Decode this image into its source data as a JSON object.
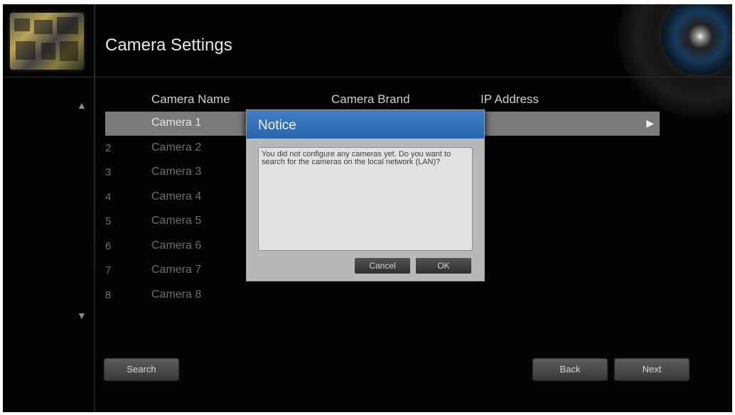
{
  "header": {
    "title": "Camera Settings"
  },
  "columns": {
    "name": "Camera Name",
    "brand": "Camera Brand",
    "ip": "IP Address"
  },
  "cameras": [
    {
      "num": "",
      "name": "Camera 1",
      "selected": true
    },
    {
      "num": "2",
      "name": "Camera 2"
    },
    {
      "num": "3",
      "name": "Camera 3"
    },
    {
      "num": "4",
      "name": "Camera 4"
    },
    {
      "num": "5",
      "name": "Camera 5"
    },
    {
      "num": "6",
      "name": "Camera 6"
    },
    {
      "num": "7",
      "name": "Camera 7"
    },
    {
      "num": "8",
      "name": "Camera 8"
    }
  ],
  "nav": {
    "up_icon": "up-arrow-icon",
    "down_icon": "down-arrow-icon",
    "play_icon": "play-right-icon"
  },
  "dialog": {
    "title": "Notice",
    "message": "You did not configure any cameras yet. Do you want to search for the cameras on the local network (LAN)?",
    "cancel_label": "Cancel",
    "ok_label": "OK"
  },
  "footer": {
    "search_label": "Search",
    "back_label": "Back",
    "next_label": "Next"
  },
  "colors": {
    "background": "#040404",
    "dialog_header": "#2f6db6",
    "selected_row": "#7a7a7a"
  }
}
